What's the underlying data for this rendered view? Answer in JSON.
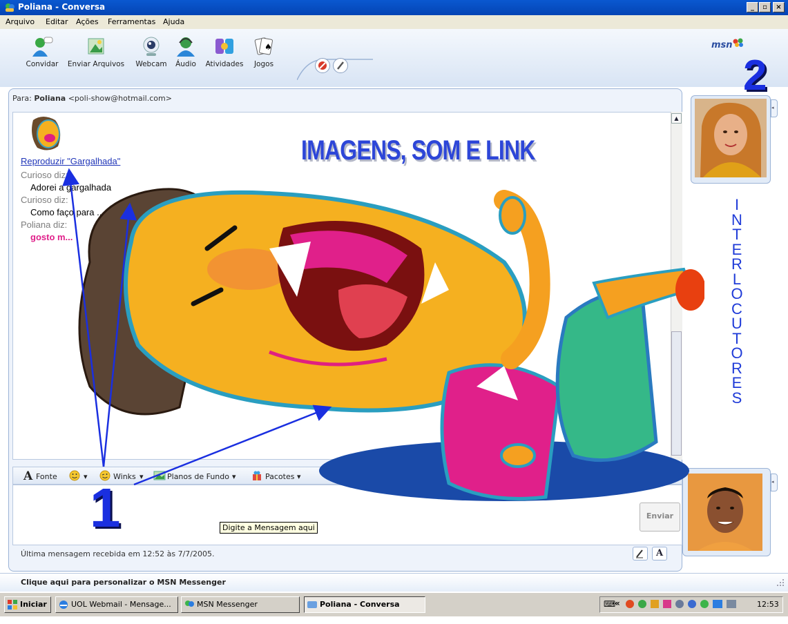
{
  "window": {
    "title": "Poliana - Conversa"
  },
  "menu": [
    "Arquivo",
    "Editar",
    "Ações",
    "Ferramentas",
    "Ajuda"
  ],
  "toolbar": {
    "buttons": [
      "Convidar",
      "Enviar Arquivos",
      "Webcam",
      "Áudio",
      "Atividades",
      "Jogos"
    ],
    "logo": "msn"
  },
  "conversation": {
    "to_label": "Para:",
    "to_name": "Poliana",
    "to_email": "<poli-show@hotmail.com>",
    "link": "Reproduzir \"Gargalhada\"",
    "messages": [
      {
        "says": "Curioso diz:",
        "text": "Adorei a gargalhada"
      },
      {
        "says": "Curioso diz:",
        "text": "Como faço para ... meu computador"
      },
      {
        "says": "Poliana diz:",
        "text": "gosto m..."
      }
    ]
  },
  "format_bar": [
    "Fonte",
    "Winks",
    "Planos de Fundo",
    "Pacotes"
  ],
  "input": {
    "tooltip": "Digite a Mensagem aqui",
    "send_label": "Enviar"
  },
  "status": "Última mensagem recebida em 12:52 às 7/7/2005.",
  "customize": "Clique aqui para personalizar o MSN Messenger",
  "taskbar": {
    "start": "Iniciar",
    "tasks": [
      "UOL Webmail - Mensage...",
      "MSN Messenger",
      "Poliana - Conversa"
    ],
    "clock": "12:53"
  },
  "annotations": {
    "headline": "IMAGENS, SOM E LINK",
    "number_1": "1",
    "number_2": "2",
    "vertical_word": "INTERLOCUTORES"
  },
  "colors": {
    "title_blue": "#0a58d0",
    "annotation_blue": "#1a2fe0",
    "link_blue": "#1f35b8",
    "message_pink": "#e0208a"
  }
}
